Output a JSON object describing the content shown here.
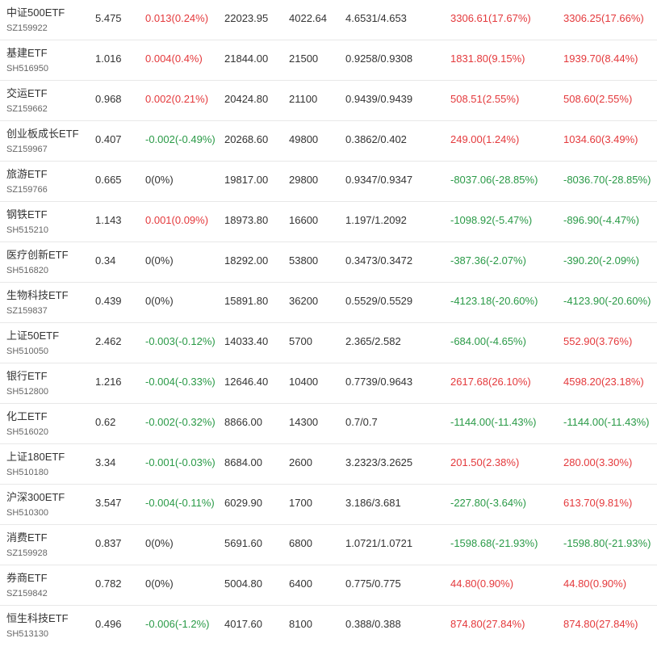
{
  "colors": {
    "up": "#e4393c",
    "down": "#2a9a47",
    "flat": "#333333"
  },
  "rows": [
    {
      "name": "中证500ETF",
      "code": "SZ159922",
      "price": "5.475",
      "change": "0.013(0.24%)",
      "change_dir": "up",
      "vol": "22023.95",
      "shares": "4022.64",
      "nav": "4.6531/4.653",
      "prem1": "3306.61(17.67%)",
      "prem1_dir": "up",
      "prem2": "3306.25(17.66%)",
      "prem2_dir": "up"
    },
    {
      "name": "基建ETF",
      "code": "SH516950",
      "price": "1.016",
      "change": "0.004(0.4%)",
      "change_dir": "up",
      "vol": "21844.00",
      "shares": "21500",
      "nav": "0.9258/0.9308",
      "prem1": "1831.80(9.15%)",
      "prem1_dir": "up",
      "prem2": "1939.70(8.44%)",
      "prem2_dir": "up"
    },
    {
      "name": "交运ETF",
      "code": "SZ159662",
      "price": "0.968",
      "change": "0.002(0.21%)",
      "change_dir": "up",
      "vol": "20424.80",
      "shares": "21100",
      "nav": "0.9439/0.9439",
      "prem1": "508.51(2.55%)",
      "prem1_dir": "up",
      "prem2": "508.60(2.55%)",
      "prem2_dir": "up"
    },
    {
      "name": "创业板成长ETF",
      "code": "SZ159967",
      "price": "0.407",
      "change": "-0.002(-0.49%)",
      "change_dir": "down",
      "vol": "20268.60",
      "shares": "49800",
      "nav": "0.3862/0.402",
      "prem1": "249.00(1.24%)",
      "prem1_dir": "up",
      "prem2": "1034.60(3.49%)",
      "prem2_dir": "up"
    },
    {
      "name": "旅游ETF",
      "code": "SZ159766",
      "price": "0.665",
      "change": "0(0%)",
      "change_dir": "flat",
      "vol": "19817.00",
      "shares": "29800",
      "nav": "0.9347/0.9347",
      "prem1": "-8037.06(-28.85%)",
      "prem1_dir": "down",
      "prem2": "-8036.70(-28.85%)",
      "prem2_dir": "down"
    },
    {
      "name": "钢铁ETF",
      "code": "SH515210",
      "price": "1.143",
      "change": "0.001(0.09%)",
      "change_dir": "up",
      "vol": "18973.80",
      "shares": "16600",
      "nav": "1.197/1.2092",
      "prem1": "-1098.92(-5.47%)",
      "prem1_dir": "down",
      "prem2": "-896.90(-4.47%)",
      "prem2_dir": "down"
    },
    {
      "name": "医疗创新ETF",
      "code": "SH516820",
      "price": "0.34",
      "change": "0(0%)",
      "change_dir": "flat",
      "vol": "18292.00",
      "shares": "53800",
      "nav": "0.3473/0.3472",
      "prem1": "-387.36(-2.07%)",
      "prem1_dir": "down",
      "prem2": "-390.20(-2.09%)",
      "prem2_dir": "down"
    },
    {
      "name": "生物科技ETF",
      "code": "SZ159837",
      "price": "0.439",
      "change": "0(0%)",
      "change_dir": "flat",
      "vol": "15891.80",
      "shares": "36200",
      "nav": "0.5529/0.5529",
      "prem1": "-4123.18(-20.60%)",
      "prem1_dir": "down",
      "prem2": "-4123.90(-20.60%)",
      "prem2_dir": "down"
    },
    {
      "name": "上证50ETF",
      "code": "SH510050",
      "price": "2.462",
      "change": "-0.003(-0.12%)",
      "change_dir": "down",
      "vol": "14033.40",
      "shares": "5700",
      "nav": "2.365/2.582",
      "prem1": "-684.00(-4.65%)",
      "prem1_dir": "down",
      "prem2": "552.90(3.76%)",
      "prem2_dir": "up"
    },
    {
      "name": "银行ETF",
      "code": "SH512800",
      "price": "1.216",
      "change": "-0.004(-0.33%)",
      "change_dir": "down",
      "vol": "12646.40",
      "shares": "10400",
      "nav": "0.7739/0.9643",
      "prem1": "2617.68(26.10%)",
      "prem1_dir": "up",
      "prem2": "4598.20(23.18%)",
      "prem2_dir": "up"
    },
    {
      "name": "化工ETF",
      "code": "SH516020",
      "price": "0.62",
      "change": "-0.002(-0.32%)",
      "change_dir": "down",
      "vol": "8866.00",
      "shares": "14300",
      "nav": "0.7/0.7",
      "prem1": "-1144.00(-11.43%)",
      "prem1_dir": "down",
      "prem2": "-1144.00(-11.43%)",
      "prem2_dir": "down"
    },
    {
      "name": "上证180ETF",
      "code": "SH510180",
      "price": "3.34",
      "change": "-0.001(-0.03%)",
      "change_dir": "down",
      "vol": "8684.00",
      "shares": "2600",
      "nav": "3.2323/3.2625",
      "prem1": "201.50(2.38%)",
      "prem1_dir": "up",
      "prem2": "280.00(3.30%)",
      "prem2_dir": "up"
    },
    {
      "name": "沪深300ETF",
      "code": "SH510300",
      "price": "3.547",
      "change": "-0.004(-0.11%)",
      "change_dir": "down",
      "vol": "6029.90",
      "shares": "1700",
      "nav": "3.186/3.681",
      "prem1": "-227.80(-3.64%)",
      "prem1_dir": "down",
      "prem2": "613.70(9.81%)",
      "prem2_dir": "up"
    },
    {
      "name": "消费ETF",
      "code": "SZ159928",
      "price": "0.837",
      "change": "0(0%)",
      "change_dir": "flat",
      "vol": "5691.60",
      "shares": "6800",
      "nav": "1.0721/1.0721",
      "prem1": "-1598.68(-21.93%)",
      "prem1_dir": "down",
      "prem2": "-1598.80(-21.93%)",
      "prem2_dir": "down"
    },
    {
      "name": "券商ETF",
      "code": "SZ159842",
      "price": "0.782",
      "change": "0(0%)",
      "change_dir": "flat",
      "vol": "5004.80",
      "shares": "6400",
      "nav": "0.775/0.775",
      "prem1": "44.80(0.90%)",
      "prem1_dir": "up",
      "prem2": "44.80(0.90%)",
      "prem2_dir": "up"
    },
    {
      "name": "恒生科技ETF",
      "code": "SH513130",
      "price": "0.496",
      "change": "-0.006(-1.2%)",
      "change_dir": "down",
      "vol": "4017.60",
      "shares": "8100",
      "nav": "0.388/0.388",
      "prem1": "874.80(27.84%)",
      "prem1_dir": "up",
      "prem2": "874.80(27.84%)",
      "prem2_dir": "up"
    }
  ]
}
